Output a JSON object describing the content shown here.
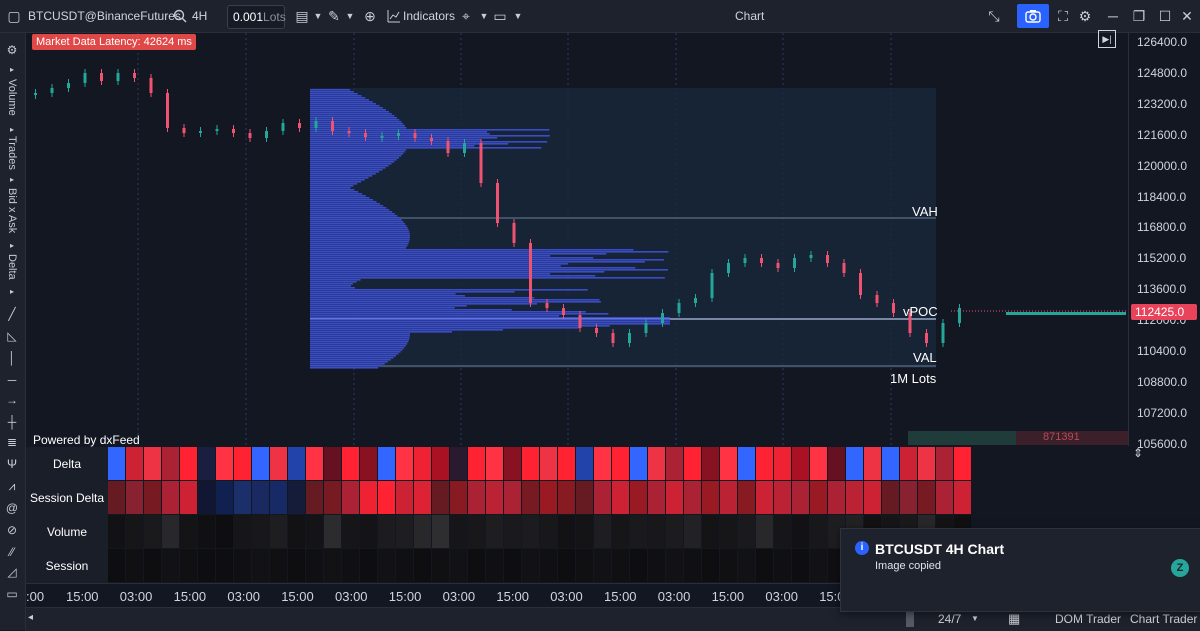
{
  "toolbar": {
    "symbol": "BTCUSDT@BinanceFutures",
    "interval": "4H",
    "lots_value": "0.001",
    "lots_unit": "Lots",
    "indicators_label": "Indicators",
    "window_title": "Chart"
  },
  "left_toolbar": {
    "vertical_tabs": [
      "Volume",
      "Trades",
      "Bid x Ask",
      "Delta"
    ]
  },
  "chart": {
    "latency_badge": "Market Data Latency: 42624 ms",
    "powered_by": "Powered by dxFeed",
    "current_price": "112425.0",
    "volume_readout": "871391",
    "profile_labels": {
      "vah": "VAH",
      "vpoc": "vPOC",
      "val": "VAL",
      "size": "1M Lots"
    },
    "colors": {
      "up": "#26a69a",
      "down": "#ef5370",
      "profile": "#3f51d8",
      "background": "#131722"
    }
  },
  "price_axis": [
    "126400.0",
    "124800.0",
    "123200.0",
    "121600.0",
    "120000.0",
    "118400.0",
    "116800.0",
    "115200.0",
    "113600.0",
    "112000.0",
    "110400.0",
    "108800.0",
    "107200.0",
    "105600.0"
  ],
  "grid_rows": [
    "Delta",
    "Session Delta",
    "Volume",
    "Session Volume"
  ],
  "time_axis": [
    ":00",
    "15:00",
    "03:00",
    "15:00",
    "03:00",
    "15:00",
    "03:00",
    "15:00",
    "03:00",
    "15:00",
    "03:00",
    "15:00",
    "03:00",
    "15:00",
    "03:00",
    "15:00",
    "03:00",
    "15:00"
  ],
  "bottom_bar": {
    "session": "24/7",
    "dom_trader": "DOM Trader",
    "chart_trader": "Chart Trader"
  },
  "toast": {
    "title": "BTCUSDT 4H Chart",
    "message": "Image copied"
  }
}
